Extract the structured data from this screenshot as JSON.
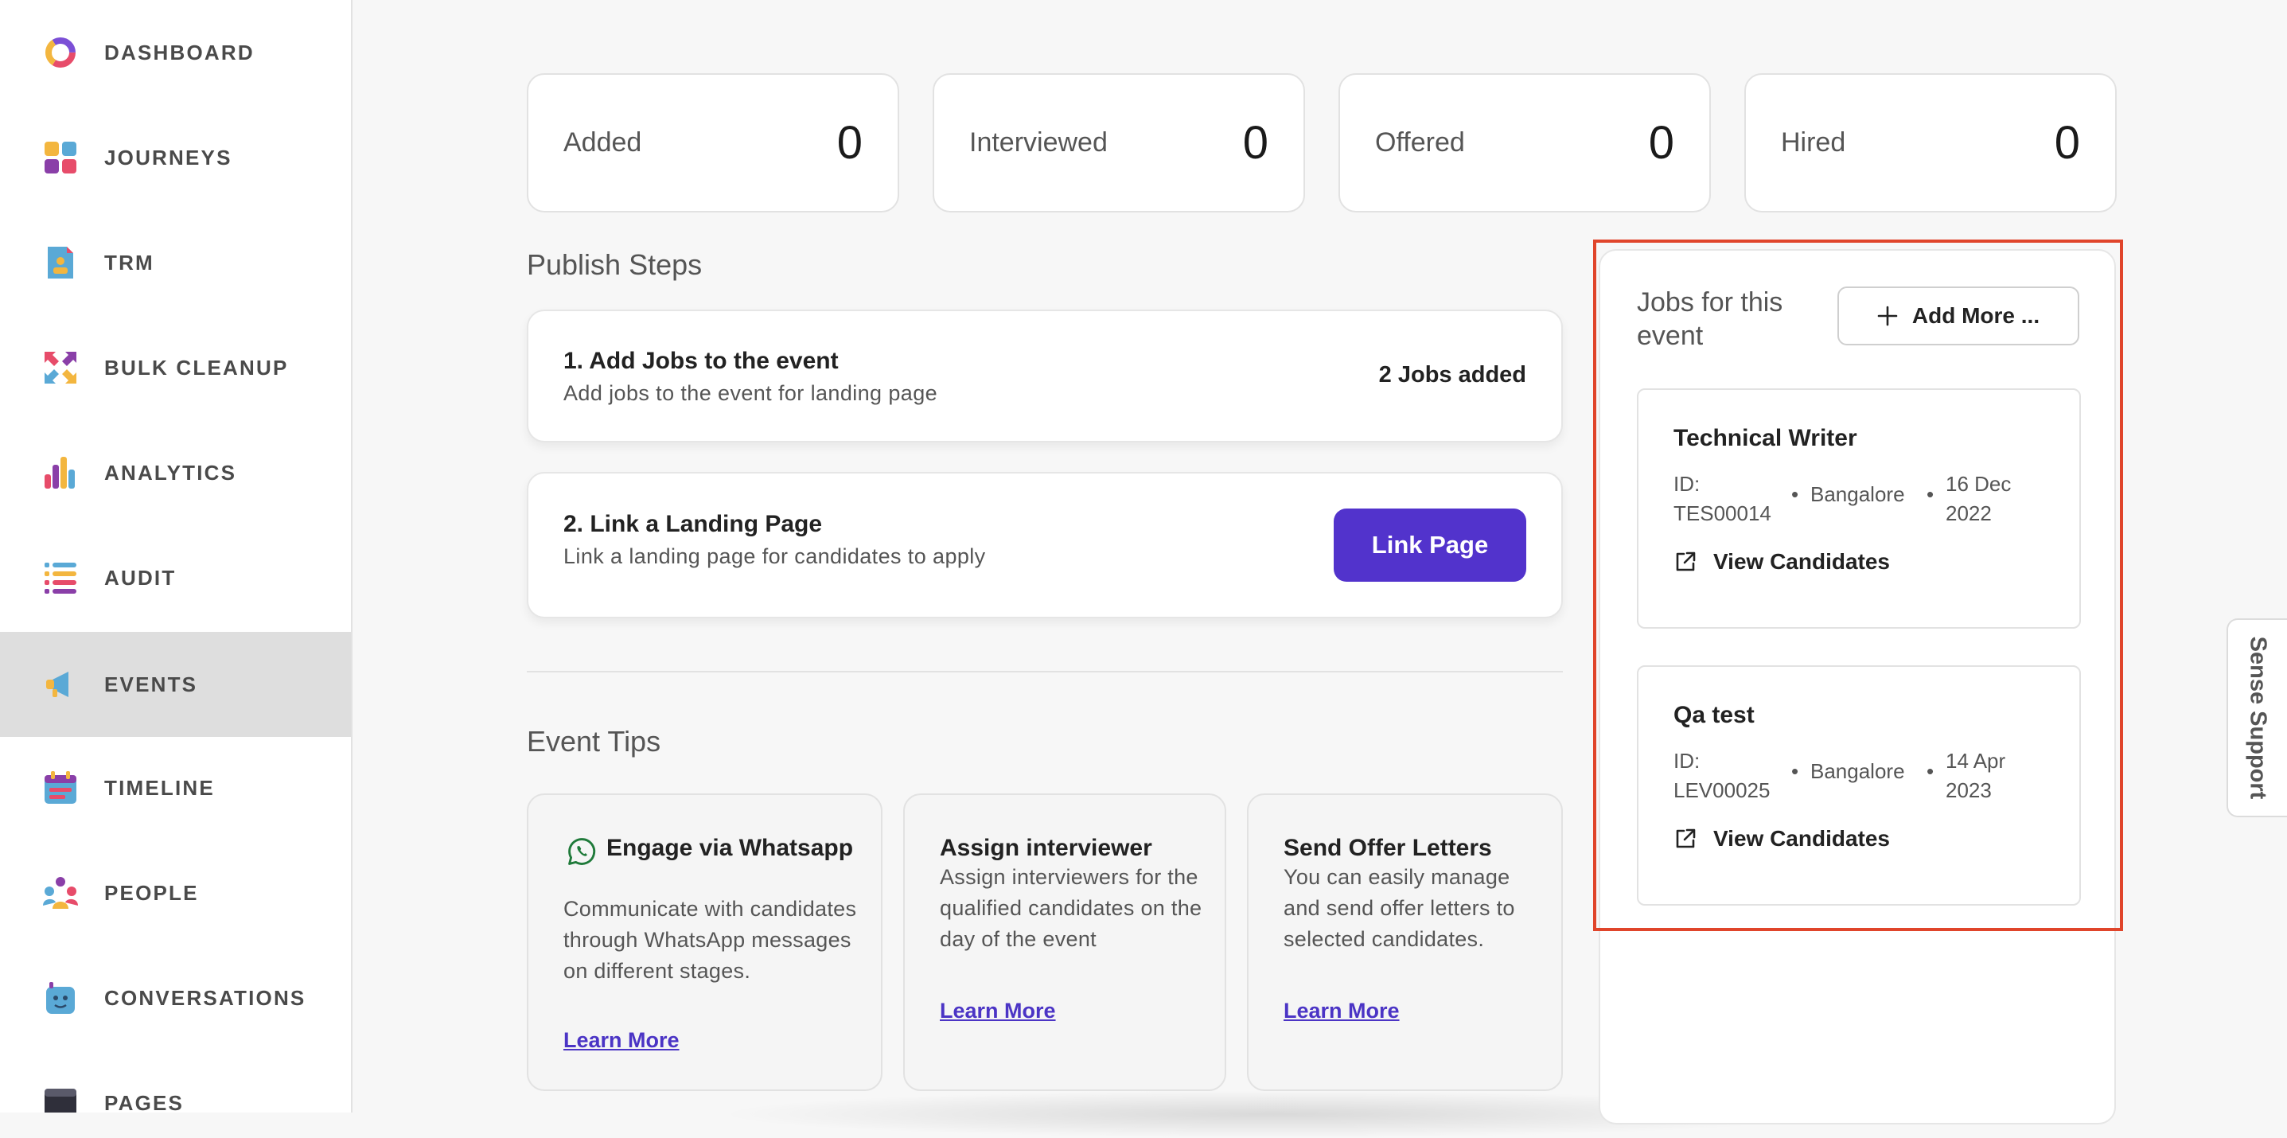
{
  "sidebar": {
    "items": [
      {
        "label": "DASHBOARD",
        "icon": "dashboard-ring-icon"
      },
      {
        "label": "JOURNEYS",
        "icon": "journeys-grid-icon"
      },
      {
        "label": "TRM",
        "icon": "trm-document-icon"
      },
      {
        "label": "BULK CLEANUP",
        "icon": "bulk-cleanup-arrows-icon"
      },
      {
        "label": "ANALYTICS",
        "icon": "analytics-bars-icon"
      },
      {
        "label": "AUDIT",
        "icon": "audit-list-icon"
      },
      {
        "label": "EVENTS",
        "icon": "events-megaphone-icon",
        "active": true
      },
      {
        "label": "TIMELINE",
        "icon": "timeline-calendar-icon"
      },
      {
        "label": "PEOPLE",
        "icon": "people-group-icon"
      },
      {
        "label": "CONVERSATIONS",
        "icon": "conversations-bot-icon"
      },
      {
        "label": "PAGES",
        "icon": "pages-browser-icon"
      }
    ]
  },
  "stats": [
    {
      "label": "Added",
      "value": "0"
    },
    {
      "label": "Interviewed",
      "value": "0"
    },
    {
      "label": "Offered",
      "value": "0"
    },
    {
      "label": "Hired",
      "value": "0"
    }
  ],
  "publish": {
    "title": "Publish Steps",
    "steps": [
      {
        "title": "1. Add Jobs to the event",
        "description": "Add jobs to the event for landing page",
        "status": "2 Jobs added"
      },
      {
        "title": "2. Link a Landing Page",
        "description": "Link a landing page for candidates to apply",
        "button": "Link Page"
      }
    ]
  },
  "tips": {
    "title": "Event Tips",
    "cards": [
      {
        "title": "Engage via Whatsapp",
        "body": "Communicate with candidates through WhatsApp messages on different stages.",
        "link": "Learn More",
        "icon": "whatsapp-icon"
      },
      {
        "title": "Assign interviewer",
        "body": "Assign interviewers for the qualified candidates on the day of the event",
        "link": "Learn More"
      },
      {
        "title": "Send Offer Letters",
        "body": "You can easily manage and send offer letters to selected candidates.",
        "link": "Learn More"
      }
    ]
  },
  "jobs": {
    "title": "Jobs for this event",
    "add_more_label": "Add More ...",
    "items": [
      {
        "title": "Technical Writer",
        "id": "ID: TES00014",
        "location": "Bangalore",
        "date": "16 Dec 2022",
        "link": "View Candidates"
      },
      {
        "title": "Qa test",
        "id": "ID: LEV00025",
        "location": "Bangalore",
        "date": "14 Apr 2023",
        "link": "View Candidates"
      }
    ]
  },
  "support": {
    "label": "Sense Support"
  },
  "colors": {
    "accent": "#5233cc",
    "highlight": "#e0452b",
    "link": "#4b34c5",
    "active_nav": "#dedede"
  }
}
